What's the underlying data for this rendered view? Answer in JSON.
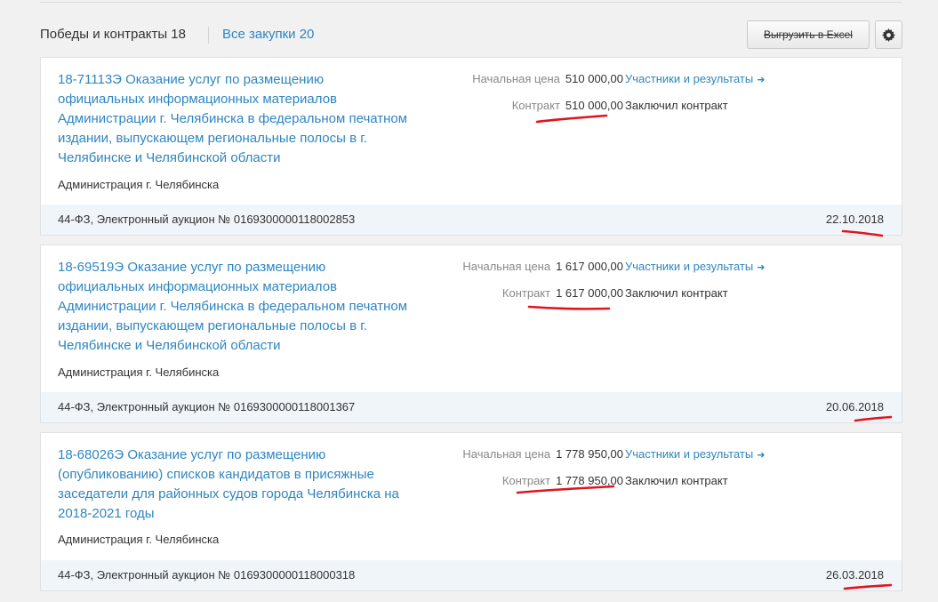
{
  "header": {
    "tab_main": "Победы и контракты 18",
    "tab_all": "Все закупки 20",
    "excel_button": "Выгрузить в Excel"
  },
  "cards": [
    {
      "title": "18-71113Э Оказание услуг по размещению официальных информационных материалов Администрации г. Челябинска в федеральном печатном издании, выпускающем региональные полосы в г. Челябинске и Челябинской области",
      "customer": "Администрация г. Челябинска",
      "start_price_label": "Начальная цена",
      "start_price": "510 000,00",
      "contract_label": "Контракт",
      "contract_price": "510 000,00",
      "participants_link": "Участники и результаты",
      "status": "Заключил контракт",
      "law": "44-ФЗ, Электронный аукцион № 0169300000118002853",
      "date": "22.10.2018"
    },
    {
      "title": "18-69519Э Оказание услуг по размещению официальных информационных материалов Администрации г. Челябинска в федеральном печатном издании, выпускающем региональные полосы в г. Челябинске и Челябинской области",
      "customer": "Администрация г. Челябинска",
      "start_price_label": "Начальная цена",
      "start_price": "1 617 000,00",
      "contract_label": "Контракт",
      "contract_price": "1 617 000,00",
      "participants_link": "Участники и результаты",
      "status": "Заключил контракт",
      "law": "44-ФЗ, Электронный аукцион № 0169300000118001367",
      "date": "20.06.2018"
    },
    {
      "title": "18-68026Э Оказание услуг по размещению (опубликованию) списков кандидатов в присяжные заседатели для районных судов города Челябинска на 2018-2021 годы",
      "customer": "Администрация г. Челябинска",
      "start_price_label": "Начальная цена",
      "start_price": "1 778 950,00",
      "contract_label": "Контракт",
      "contract_price": "1 778 950,00",
      "participants_link": "Участники и результаты",
      "status": "Заключил контракт",
      "law": "44-ФЗ, Электронный аукцион № 0169300000118000318",
      "date": "26.03.2018"
    }
  ],
  "colors": {
    "link": "#2e86c1",
    "footer_bg": "#f0f5fa",
    "annotation": "#e0141e"
  }
}
